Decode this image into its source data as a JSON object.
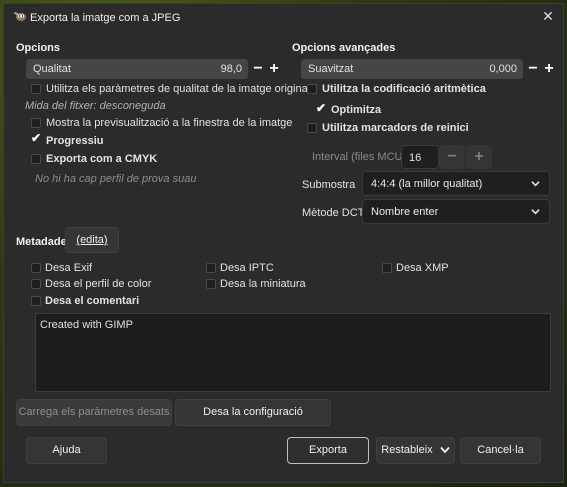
{
  "window": {
    "title": "Exporta la imatge com a JPEG",
    "icon": "gimp-wilber-icon"
  },
  "options": {
    "header": "Opcions",
    "quality_label": "Qualitat",
    "quality_value": "98,0",
    "use_quality_label": "Utilitza els paràmetres de qualitat de la imatge original",
    "use_quality_checked": false,
    "file_size_label": "Mida del fitxer: desconeguda",
    "preview_label": "Mostra la previsualització a la finestra de la imatge",
    "preview_checked": false,
    "progressive_label": "Progressiu",
    "progressive_checked": true,
    "cmyk_label": "Exporta com a CMYK",
    "cmyk_checked": false,
    "proof_profile_note": "No hi ha cap perfil de prova suau"
  },
  "advanced": {
    "header": "Opcions avançades",
    "smoothing_label": "Suavitzat",
    "smoothing_value": "0,000",
    "arithmetic_label": "Utilitza la codificació aritmètica",
    "arithmetic_checked": false,
    "optimize_label": "Optimitza",
    "optimize_checked": true,
    "restart_label": "Utilitza marcadors de reinici",
    "restart_checked": false,
    "interval_label": "Interval (files MCU):",
    "interval_value": "16",
    "subsampling_label": "Submostra",
    "subsampling_value": "4:4:4 (la millor qualitat)",
    "dct_label": "Mètode DCT",
    "dct_value": "Nombre enter"
  },
  "metadata": {
    "header": "Metadades",
    "edit_label": "(edita)",
    "save_exif": "Desa Exif",
    "save_iptc": "Desa IPTC",
    "save_xmp": "Desa XMP",
    "save_color_profile": "Desa el perfil de color",
    "save_thumbnail": "Desa la miniatura",
    "save_comment": "Desa el comentari",
    "comment_text": "Created with GIMP"
  },
  "buttons": {
    "load_defaults": "Carrega els paràmetres desats",
    "save_defaults": "Desa la configuració",
    "help": "Ajuda",
    "export": "Exporta",
    "reset": "Restableix",
    "cancel": "Cancel·la"
  },
  "colors": {
    "dialog_bg": "#2b2b2b",
    "field_bg": "#454545",
    "accent_text": "#ffffff"
  }
}
